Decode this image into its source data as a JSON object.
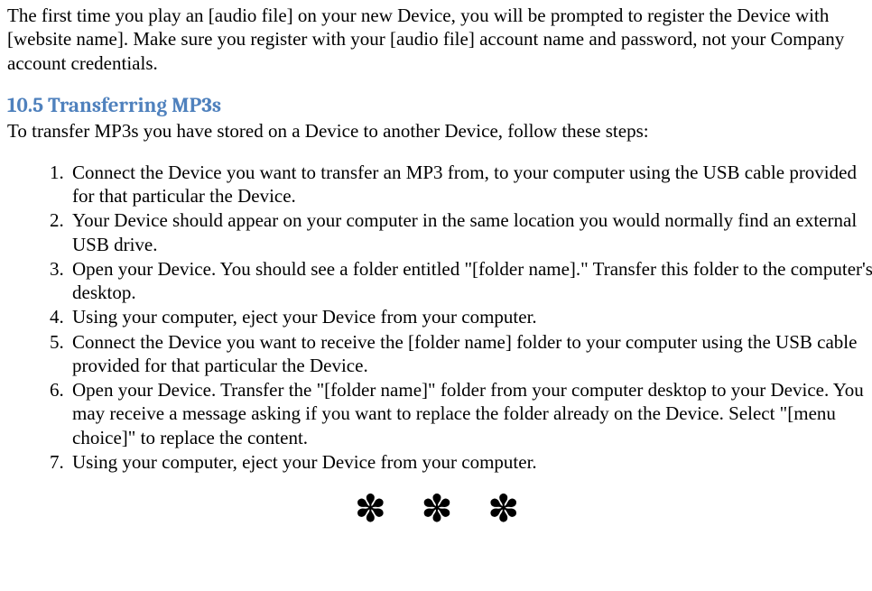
{
  "intro": "The first time you play an [audio file] on your new Device, you will be prompted to register the Device with [website name]. Make sure you register with your [audio file] account name and password, not your Company account credentials.",
  "section": {
    "heading": "10.5 Transferring MP3s",
    "intro": "To transfer MP3s you have stored on a Device to another Device, follow these steps:",
    "steps": [
      "Connect the Device you want to transfer an MP3 from, to your computer using the USB cable provided for that particular the Device.",
      "Your Device should appear on your computer in the same location you would normally find an external USB drive.",
      "Open your Device. You should see a folder entitled \"[folder name].\" Transfer this folder to the computer's desktop.",
      "Using your computer, eject your Device from your computer.",
      "Connect the Device you want to receive the [folder name] folder to your computer using the USB cable provided for that particular the Device.",
      "Open your Device. Transfer the \"[folder name]\" folder from your computer desktop to your Device. You may receive a message asking if you want to replace the folder already on the Device. Select \"[menu choice]\" to replace the content.",
      "Using your computer, eject your Device from your computer."
    ]
  },
  "separator": "✽ ✽ ✽"
}
